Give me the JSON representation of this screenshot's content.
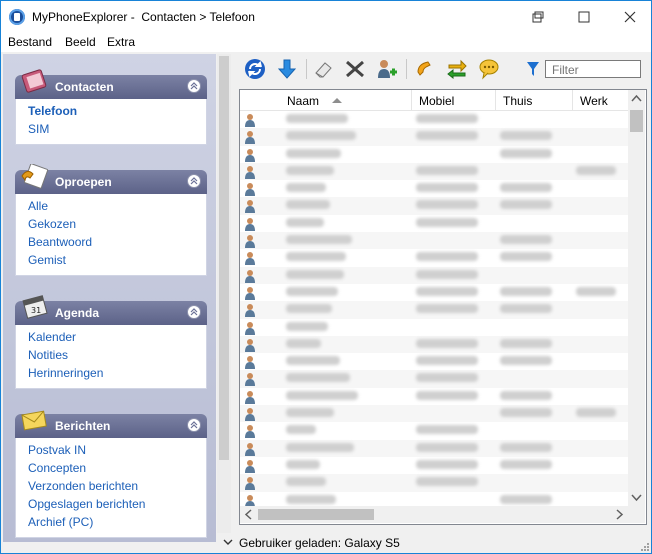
{
  "window": {
    "title": "MyPhoneExplorer -  Contacten > Telefoon"
  },
  "menu": [
    "Bestand",
    "Beeld",
    "Extra"
  ],
  "sidebar": {
    "groups": [
      {
        "title": "Contacten",
        "icon": "address-book-icon",
        "items": [
          "Telefoon",
          "SIM"
        ],
        "active": 0
      },
      {
        "title": "Oproepen",
        "icon": "phone-log-icon",
        "items": [
          "Alle",
          "Gekozen",
          "Beantwoord",
          "Gemist"
        ]
      },
      {
        "title": "Agenda",
        "icon": "calendar-icon",
        "items": [
          "Kalender",
          "Notities",
          "Herinneringen"
        ]
      },
      {
        "title": "Berichten",
        "icon": "envelope-icon",
        "items": [
          "Postvak IN",
          "Concepten",
          "Verzonden berichten",
          "Opgeslagen berichten",
          "Archief (PC)"
        ]
      }
    ]
  },
  "toolbar": {
    "icons": [
      "refresh-icon",
      "download-icon",
      "eraser-icon",
      "delete-icon",
      "add-contact-icon",
      "call-icon",
      "sync-icon",
      "message-icon",
      "filter-icon"
    ],
    "filter_placeholder": "Filter"
  },
  "grid": {
    "columns": [
      "Naam",
      "Mobiel",
      "Thuis",
      "Werk"
    ],
    "sorted_column": "Naam",
    "row_count": 23
  },
  "status": {
    "text": "Gebruiker geladen: Galaxy S5"
  },
  "colors": {
    "accent": "#1883d7",
    "link": "#1c5fb8",
    "group_header": "#6a7096"
  }
}
